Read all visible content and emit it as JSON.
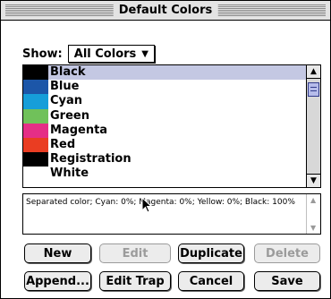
{
  "dialog": {
    "title": "Default Colors"
  },
  "show": {
    "label": "Show:",
    "selected": "All Colors"
  },
  "colors": [
    {
      "name": "Black",
      "swatch": "#000000",
      "selected": true
    },
    {
      "name": "Blue",
      "swatch": "#1c56a8"
    },
    {
      "name": "Cyan",
      "swatch": "#169ed9"
    },
    {
      "name": "Green",
      "swatch": "#70c15a"
    },
    {
      "name": "Magenta",
      "swatch": "#e52e86"
    },
    {
      "name": "Red",
      "swatch": "#ea3d22"
    },
    {
      "name": "Registration",
      "swatch": "#000000"
    },
    {
      "name": "White",
      "swatch": "#ffffff"
    }
  ],
  "description": "Separated color; Cyan: 0%; Magenta: 0%; Yellow: 0%; Black: 100%",
  "buttons": {
    "new": "New",
    "edit": "Edit",
    "duplicate": "Duplicate",
    "delete": "Delete",
    "append": "Append...",
    "edit_trap": "Edit Trap",
    "cancel": "Cancel",
    "save": "Save"
  },
  "selection_color": "#c4c8e3",
  "scroll_thumb_color": "#b6bcea",
  "icons": {
    "scroll_up": "arrow-up-icon",
    "scroll_down": "arrow-down-icon",
    "popup": "triangle-down-icon",
    "cursor": "mouse-pointer-icon"
  }
}
